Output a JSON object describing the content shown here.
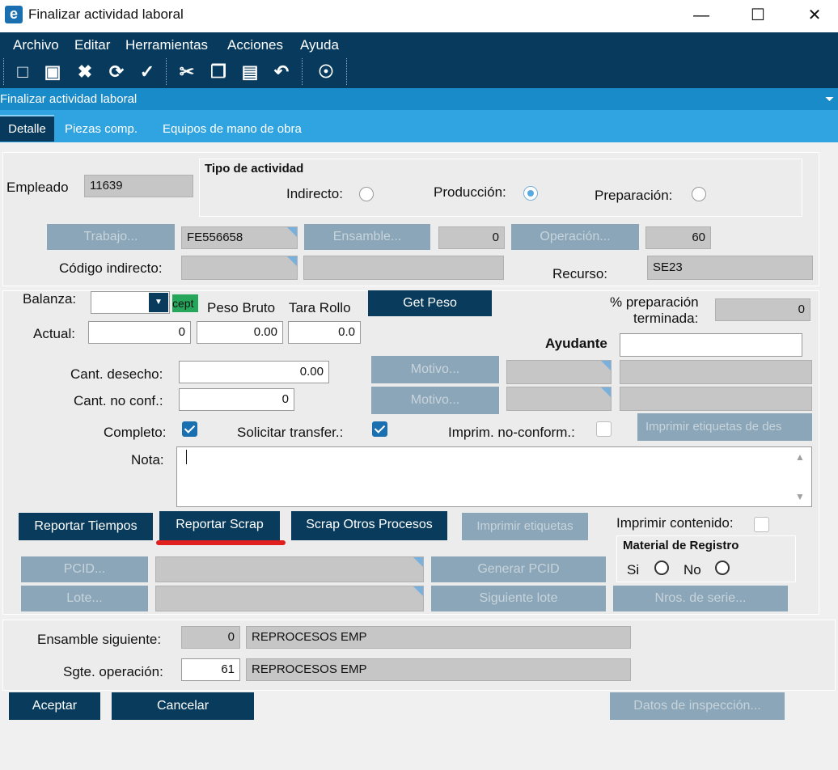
{
  "window": {
    "title": "Finalizar actividad laboral",
    "logo_letter": "e"
  },
  "menu": [
    "Archivo",
    "Editar",
    "Herramientas",
    "Acciones",
    "Ayuda"
  ],
  "toolbar_icons": [
    "new-icon",
    "save-icon",
    "delete-icon",
    "refresh-icon",
    "clear-icon",
    "cut-icon",
    "copy-icon",
    "paste-icon",
    "undo-icon",
    "search-icon"
  ],
  "panel": {
    "title": "Finalizar actividad laboral"
  },
  "tabs": [
    "Detalle",
    "Piezas comp.",
    "Equipos de mano de obra"
  ],
  "empleado": {
    "label": "Empleado",
    "value": "11639"
  },
  "tipo_actividad": {
    "title": "Tipo de actividad",
    "indirecto": "Indirecto:",
    "produccion": "Producción:",
    "preparacion": "Preparación:",
    "selected": "Producción"
  },
  "trabajo": {
    "button": "Trabajo...",
    "value": "FE556658"
  },
  "ensamble": {
    "button": "Ensamble...",
    "value": "0"
  },
  "operacion": {
    "button": "Operación...",
    "value": "60"
  },
  "codigo_indirecto": {
    "label": "Código indirecto:",
    "value": "",
    "desc": ""
  },
  "recurso": {
    "label": "Recurso:",
    "value": "SE23"
  },
  "balanza": {
    "label": "Balanza:",
    "value": "",
    "status": "cept"
  },
  "peso_bruto": {
    "label": "Peso Bruto",
    "value": "0.00"
  },
  "tara_rollo": {
    "label": "Tara Rollo",
    "value": "0.0"
  },
  "get_peso": "Get Peso",
  "actual": {
    "label": "Actual:",
    "value": "0"
  },
  "preparacion_terminada": {
    "label_line1": "% preparación",
    "label_line2": "terminada:",
    "value": "0"
  },
  "ayudante": {
    "label": "Ayudante",
    "value": ""
  },
  "cant_desecho": {
    "label": "Cant. desecho:",
    "value": "0.00",
    "motivo": "Motivo..."
  },
  "cant_no_conf": {
    "label": "Cant. no conf.:",
    "value": "0",
    "motivo": "Motivo..."
  },
  "completo": {
    "label": "Completo:",
    "checked": true
  },
  "solicitar_transfer": {
    "label": "Solicitar transfer.:",
    "checked": true
  },
  "imprim_no_conform": {
    "label": "Imprim. no-conform.:",
    "checked": false
  },
  "imprimir_etiquetas_des": "Imprimir etiquetas de des",
  "nota": {
    "label": "Nota:",
    "value": ""
  },
  "buttons": {
    "reportar_tiempos": "Reportar Tiempos",
    "reportar_scrap": "Reportar Scrap",
    "scrap_otros": "Scrap Otros Procesos",
    "imprimir_etiquetas": "Imprimir etiquetas",
    "pcid": "PCID...",
    "generar_pcid": "Generar PCID",
    "lote": "Lote...",
    "siguiente_lote": "Siguiente lote",
    "nros_serie": "Nros. de serie...",
    "aceptar": "Aceptar",
    "cancelar": "Cancelar",
    "datos_inspeccion": "Datos de inspección..."
  },
  "imprimir_contenido": {
    "label": "Imprimir contenido:",
    "checked": false
  },
  "material_registro": {
    "title": "Material de Registro",
    "si": "Si",
    "no": "No"
  },
  "ensamble_siguiente": {
    "label": "Ensamble siguiente:",
    "value": "0",
    "desc": "REPROCESOS EMP"
  },
  "sgte_operacion": {
    "label": "Sgte. operación:",
    "value": "61",
    "desc": "REPROCESOS EMP"
  },
  "colors": {
    "dark_blue": "#083b5c",
    "tab_blue": "#2fa4e0",
    "highlight_red": "#e0201f"
  }
}
